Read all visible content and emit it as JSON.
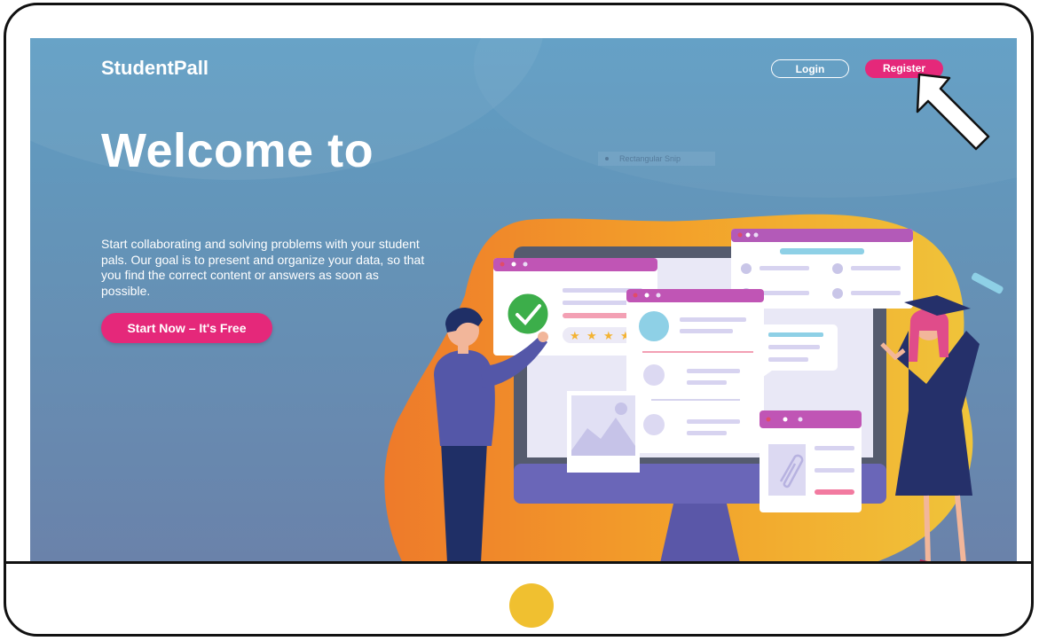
{
  "header": {
    "logo": "StudentPall",
    "login_label": "Login",
    "register_label": "Register"
  },
  "hero": {
    "title": "Welcome to",
    "description": "Start collaborating and solving problems with your student pals. Our goal is to present and organize your data, so that you find the correct content or answers as soon as possible.",
    "cta_label": "Start Now – It's Free"
  },
  "overlay": {
    "snip_label": "Rectangular Snip"
  },
  "colors": {
    "accent": "#e5287a",
    "background_top": "#5f9ec4",
    "background_bottom": "#6a82aa",
    "home_button": "#f0c030"
  },
  "icons": [
    "check-icon",
    "star-icon",
    "image-icon",
    "paperclip-icon",
    "pointer-arrow-icon"
  ],
  "rating": {
    "stars": 4
  }
}
